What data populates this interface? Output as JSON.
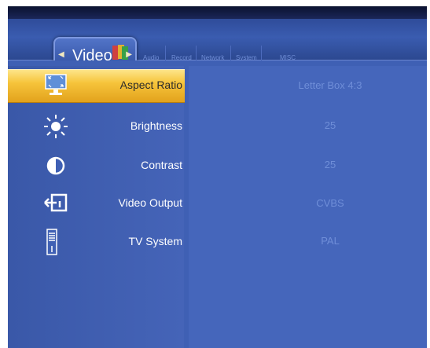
{
  "tabs": {
    "active": "Video",
    "others": [
      "Audio",
      "Record",
      "Network",
      "System",
      "MISC"
    ]
  },
  "menu": [
    {
      "label": "Aspect Ratio",
      "value": "Letter Box 4:3",
      "icon": "aspect-ratio-icon",
      "selected": true
    },
    {
      "label": "Brightness",
      "value": "25",
      "icon": "brightness-icon",
      "selected": false
    },
    {
      "label": "Contrast",
      "value": "25",
      "icon": "contrast-icon",
      "selected": false
    },
    {
      "label": "Video Output",
      "value": "CVBS",
      "icon": "video-output-icon",
      "selected": false
    },
    {
      "label": "TV System",
      "value": "PAL",
      "icon": "tv-system-icon",
      "selected": false
    }
  ],
  "colors": {
    "background": "#3f60b4",
    "highlight": "#f6c43b",
    "value_text": "#6f8ed8"
  }
}
